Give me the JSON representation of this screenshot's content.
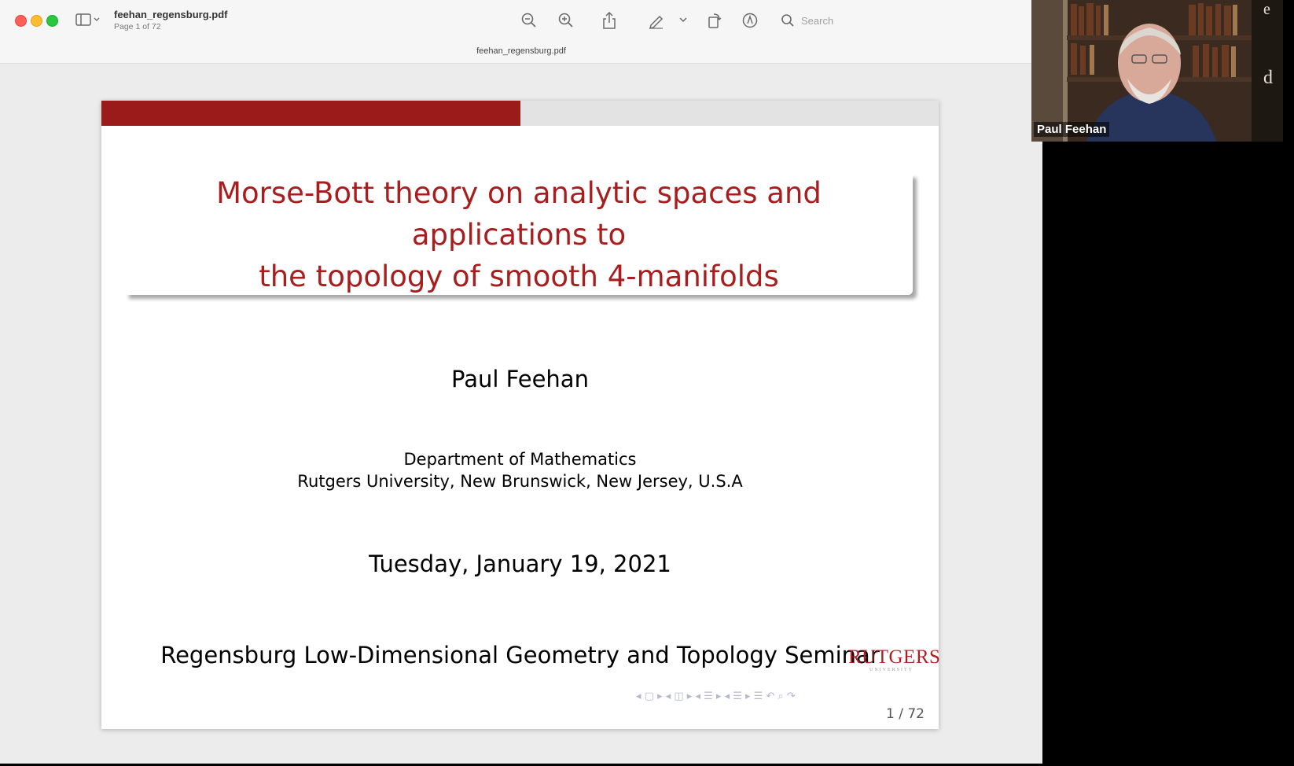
{
  "window": {
    "doc_title": "feehan_regensburg.pdf",
    "doc_subtitle": "Page 1 of 72",
    "tab_title": "feehan_regensburg.pdf",
    "search_placeholder": "Search"
  },
  "toolbar": {
    "icons": [
      "sidebar-icon",
      "zoom-out-icon",
      "zoom-in-icon",
      "share-icon",
      "markup-pen-icon",
      "chevron-down-icon",
      "rotate-icon",
      "annotate-icon",
      "search-icon"
    ]
  },
  "slide": {
    "title_line1": "Morse-Bott theory on analytic spaces and applications to",
    "title_line2": "the topology of smooth 4-manifolds",
    "author": "Paul Feehan",
    "dept_line1": "Department of Mathematics",
    "dept_line2": "Rutgers University, New Brunswick, New Jersey, U.S.A",
    "date": "Tuesday, January 19, 2021",
    "seminar": "Regensburg Low-Dimensional Geometry and Topology Seminar",
    "logo_text": "RUTGERS",
    "logo_subtext": "UNIVERSITY",
    "nav_symbols": "◂ ▢ ▸  ◂ ◫ ▸  ◂ ☰ ▸  ◂ ☰ ▸   ☰   ↶ ⌕ ↷",
    "page_number": "1 / 72",
    "colors": {
      "accent": "#9b1b1b",
      "title": "#a81e1e"
    }
  },
  "video": {
    "participant_name": "Paul Feehan"
  }
}
